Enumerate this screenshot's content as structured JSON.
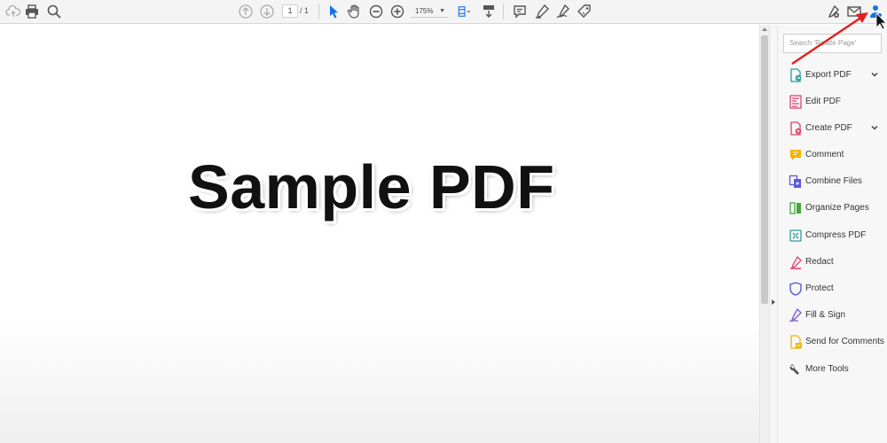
{
  "toolbar": {
    "page_current": "1",
    "page_of": "/ 1",
    "zoom": "175%",
    "accent": "#1473e6"
  },
  "document": {
    "title": "Sample PDF"
  },
  "tool_pane": {
    "search_placeholder": "Search 'Rotate Page'",
    "tools": [
      {
        "label": "Export PDF",
        "icon": "export-pdf-icon",
        "color": "#2d9d9d",
        "expandable": true
      },
      {
        "label": "Edit PDF",
        "icon": "edit-pdf-icon",
        "color": "#e0436b",
        "expandable": false
      },
      {
        "label": "Create PDF",
        "icon": "create-pdf-icon",
        "color": "#e0436b",
        "expandable": true
      },
      {
        "label": "Comment",
        "icon": "comment-icon",
        "color": "#f0b400",
        "expandable": false
      },
      {
        "label": "Combine Files",
        "icon": "combine-files-icon",
        "color": "#5a5ad6",
        "expandable": false
      },
      {
        "label": "Organize Pages",
        "icon": "organize-pages-icon",
        "color": "#44a83a",
        "expandable": false
      },
      {
        "label": "Compress PDF",
        "icon": "compress-pdf-icon",
        "color": "#2d9d9d",
        "expandable": false
      },
      {
        "label": "Redact",
        "icon": "redact-icon",
        "color": "#e0436b",
        "expandable": false
      },
      {
        "label": "Protect",
        "icon": "protect-icon",
        "color": "#5a5ad6",
        "expandable": false
      },
      {
        "label": "Fill & Sign",
        "icon": "fill-sign-icon",
        "color": "#7a57d1",
        "expandable": false
      },
      {
        "label": "Send for Comments",
        "icon": "send-for-comments-icon",
        "color": "#f0b400",
        "expandable": false
      },
      {
        "label": "More Tools",
        "icon": "more-tools-icon",
        "color": "#555555",
        "expandable": false
      }
    ]
  },
  "annotation": {
    "arrow_color": "#e02020"
  }
}
